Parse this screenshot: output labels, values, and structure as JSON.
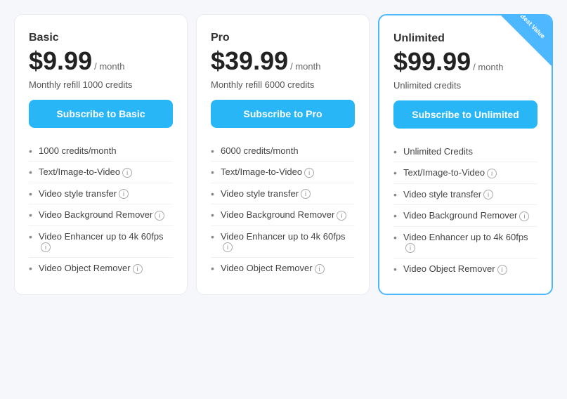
{
  "plans": [
    {
      "id": "basic",
      "name": "Basic",
      "price": "$9.99",
      "period": "/ month",
      "credits_info": "Monthly refill 1000 credits",
      "subscribe_label": "Subscribe to Basic",
      "featured": false,
      "badge": null,
      "features": [
        "1000 credits/month",
        "Text/Image-to-Video",
        "Video style transfer",
        "Video Background Remover",
        "Video Enhancer up to 4k 60fps",
        "Video Object Remover"
      ]
    },
    {
      "id": "pro",
      "name": "Pro",
      "price": "$39.99",
      "period": "/ month",
      "credits_info": "Monthly refill 6000 credits",
      "subscribe_label": "Subscribe to Pro",
      "featured": false,
      "badge": null,
      "features": [
        "6000 credits/month",
        "Text/Image-to-Video",
        "Video style transfer",
        "Video Background Remover",
        "Video Enhancer up to 4k 60fps",
        "Video Object Remover"
      ]
    },
    {
      "id": "unlimited",
      "name": "Unlimited",
      "price": "$99.99",
      "period": "/ month",
      "credits_info": "Unlimited credits",
      "subscribe_label": "Subscribe to Unlimited",
      "featured": true,
      "badge": "Best Value",
      "features": [
        "Unlimited Credits",
        "Text/Image-to-Video",
        "Video style transfer",
        "Video Background Remover",
        "Video Enhancer up to 4k 60fps",
        "Video Object Remover"
      ]
    }
  ],
  "info_icon_label": "ⓘ"
}
